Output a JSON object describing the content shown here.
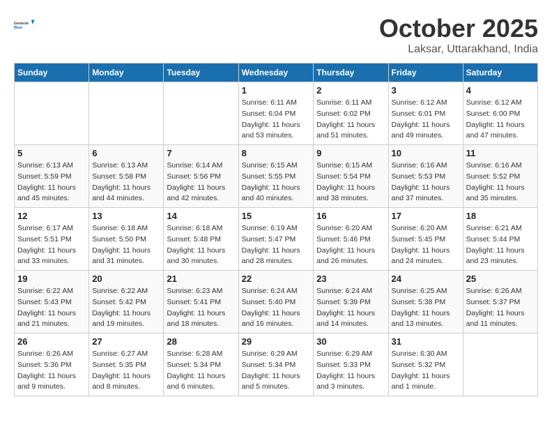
{
  "header": {
    "logo_text_general": "General",
    "logo_text_blue": "Blue",
    "month_title": "October 2025",
    "location": "Laksar, Uttarakhand, India"
  },
  "weekdays": [
    "Sunday",
    "Monday",
    "Tuesday",
    "Wednesday",
    "Thursday",
    "Friday",
    "Saturday"
  ],
  "weeks": [
    [
      {
        "day": "",
        "sunrise": "",
        "sunset": "",
        "daylight": ""
      },
      {
        "day": "",
        "sunrise": "",
        "sunset": "",
        "daylight": ""
      },
      {
        "day": "",
        "sunrise": "",
        "sunset": "",
        "daylight": ""
      },
      {
        "day": "1",
        "sunrise": "Sunrise: 6:11 AM",
        "sunset": "Sunset: 6:04 PM",
        "daylight": "Daylight: 11 hours and 53 minutes."
      },
      {
        "day": "2",
        "sunrise": "Sunrise: 6:11 AM",
        "sunset": "Sunset: 6:02 PM",
        "daylight": "Daylight: 11 hours and 51 minutes."
      },
      {
        "day": "3",
        "sunrise": "Sunrise: 6:12 AM",
        "sunset": "Sunset: 6:01 PM",
        "daylight": "Daylight: 11 hours and 49 minutes."
      },
      {
        "day": "4",
        "sunrise": "Sunrise: 6:12 AM",
        "sunset": "Sunset: 6:00 PM",
        "daylight": "Daylight: 11 hours and 47 minutes."
      }
    ],
    [
      {
        "day": "5",
        "sunrise": "Sunrise: 6:13 AM",
        "sunset": "Sunset: 5:59 PM",
        "daylight": "Daylight: 11 hours and 45 minutes."
      },
      {
        "day": "6",
        "sunrise": "Sunrise: 6:13 AM",
        "sunset": "Sunset: 5:58 PM",
        "daylight": "Daylight: 11 hours and 44 minutes."
      },
      {
        "day": "7",
        "sunrise": "Sunrise: 6:14 AM",
        "sunset": "Sunset: 5:56 PM",
        "daylight": "Daylight: 11 hours and 42 minutes."
      },
      {
        "day": "8",
        "sunrise": "Sunrise: 6:15 AM",
        "sunset": "Sunset: 5:55 PM",
        "daylight": "Daylight: 11 hours and 40 minutes."
      },
      {
        "day": "9",
        "sunrise": "Sunrise: 6:15 AM",
        "sunset": "Sunset: 5:54 PM",
        "daylight": "Daylight: 11 hours and 38 minutes."
      },
      {
        "day": "10",
        "sunrise": "Sunrise: 6:16 AM",
        "sunset": "Sunset: 5:53 PM",
        "daylight": "Daylight: 11 hours and 37 minutes."
      },
      {
        "day": "11",
        "sunrise": "Sunrise: 6:16 AM",
        "sunset": "Sunset: 5:52 PM",
        "daylight": "Daylight: 11 hours and 35 minutes."
      }
    ],
    [
      {
        "day": "12",
        "sunrise": "Sunrise: 6:17 AM",
        "sunset": "Sunset: 5:51 PM",
        "daylight": "Daylight: 11 hours and 33 minutes."
      },
      {
        "day": "13",
        "sunrise": "Sunrise: 6:18 AM",
        "sunset": "Sunset: 5:50 PM",
        "daylight": "Daylight: 11 hours and 31 minutes."
      },
      {
        "day": "14",
        "sunrise": "Sunrise: 6:18 AM",
        "sunset": "Sunset: 5:48 PM",
        "daylight": "Daylight: 11 hours and 30 minutes."
      },
      {
        "day": "15",
        "sunrise": "Sunrise: 6:19 AM",
        "sunset": "Sunset: 5:47 PM",
        "daylight": "Daylight: 11 hours and 28 minutes."
      },
      {
        "day": "16",
        "sunrise": "Sunrise: 6:20 AM",
        "sunset": "Sunset: 5:46 PM",
        "daylight": "Daylight: 11 hours and 26 minutes."
      },
      {
        "day": "17",
        "sunrise": "Sunrise: 6:20 AM",
        "sunset": "Sunset: 5:45 PM",
        "daylight": "Daylight: 11 hours and 24 minutes."
      },
      {
        "day": "18",
        "sunrise": "Sunrise: 6:21 AM",
        "sunset": "Sunset: 5:44 PM",
        "daylight": "Daylight: 11 hours and 23 minutes."
      }
    ],
    [
      {
        "day": "19",
        "sunrise": "Sunrise: 6:22 AM",
        "sunset": "Sunset: 5:43 PM",
        "daylight": "Daylight: 11 hours and 21 minutes."
      },
      {
        "day": "20",
        "sunrise": "Sunrise: 6:22 AM",
        "sunset": "Sunset: 5:42 PM",
        "daylight": "Daylight: 11 hours and 19 minutes."
      },
      {
        "day": "21",
        "sunrise": "Sunrise: 6:23 AM",
        "sunset": "Sunset: 5:41 PM",
        "daylight": "Daylight: 11 hours and 18 minutes."
      },
      {
        "day": "22",
        "sunrise": "Sunrise: 6:24 AM",
        "sunset": "Sunset: 5:40 PM",
        "daylight": "Daylight: 11 hours and 16 minutes."
      },
      {
        "day": "23",
        "sunrise": "Sunrise: 6:24 AM",
        "sunset": "Sunset: 5:39 PM",
        "daylight": "Daylight: 11 hours and 14 minutes."
      },
      {
        "day": "24",
        "sunrise": "Sunrise: 6:25 AM",
        "sunset": "Sunset: 5:38 PM",
        "daylight": "Daylight: 11 hours and 13 minutes."
      },
      {
        "day": "25",
        "sunrise": "Sunrise: 6:26 AM",
        "sunset": "Sunset: 5:37 PM",
        "daylight": "Daylight: 11 hours and 11 minutes."
      }
    ],
    [
      {
        "day": "26",
        "sunrise": "Sunrise: 6:26 AM",
        "sunset": "Sunset: 5:36 PM",
        "daylight": "Daylight: 11 hours and 9 minutes."
      },
      {
        "day": "27",
        "sunrise": "Sunrise: 6:27 AM",
        "sunset": "Sunset: 5:35 PM",
        "daylight": "Daylight: 11 hours and 8 minutes."
      },
      {
        "day": "28",
        "sunrise": "Sunrise: 6:28 AM",
        "sunset": "Sunset: 5:34 PM",
        "daylight": "Daylight: 11 hours and 6 minutes."
      },
      {
        "day": "29",
        "sunrise": "Sunrise: 6:29 AM",
        "sunset": "Sunset: 5:34 PM",
        "daylight": "Daylight: 11 hours and 5 minutes."
      },
      {
        "day": "30",
        "sunrise": "Sunrise: 6:29 AM",
        "sunset": "Sunset: 5:33 PM",
        "daylight": "Daylight: 11 hours and 3 minutes."
      },
      {
        "day": "31",
        "sunrise": "Sunrise: 6:30 AM",
        "sunset": "Sunset: 5:32 PM",
        "daylight": "Daylight: 11 hours and 1 minute."
      },
      {
        "day": "",
        "sunrise": "",
        "sunset": "",
        "daylight": ""
      }
    ]
  ]
}
